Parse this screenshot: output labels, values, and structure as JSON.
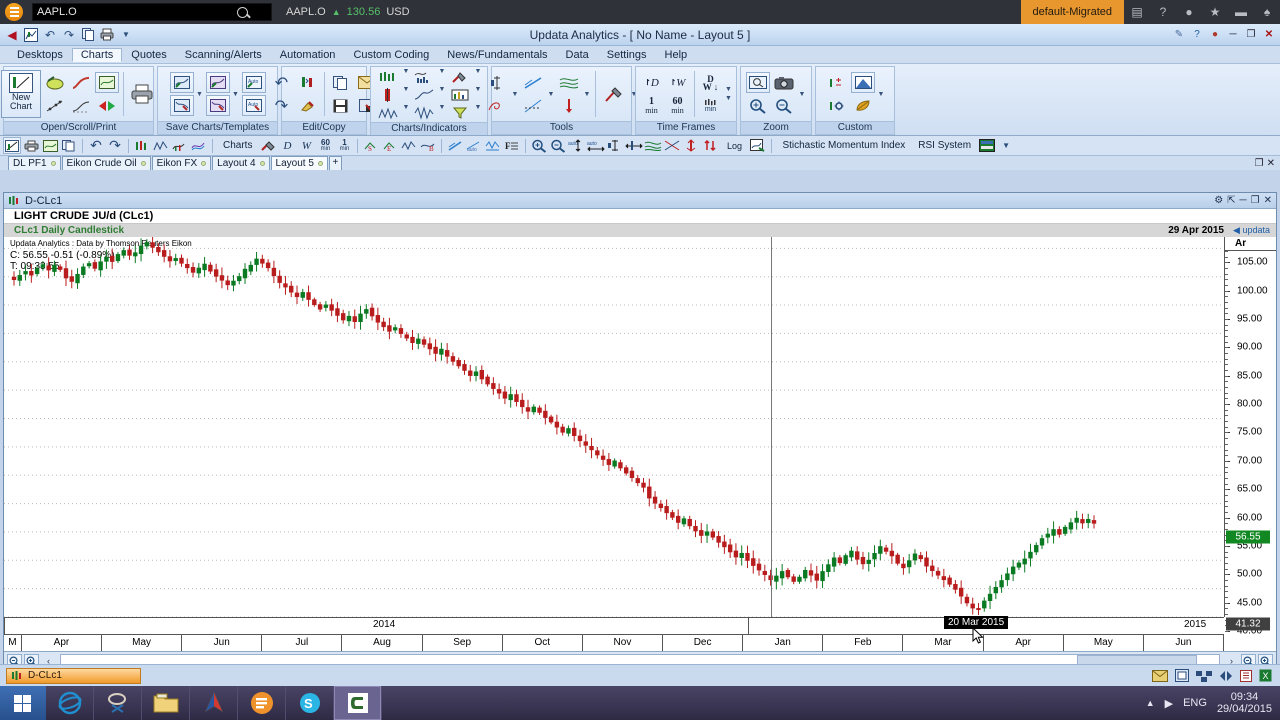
{
  "eikon": {
    "logo_icon": "eikon-logo-icon",
    "search_value": "AAPL.O",
    "search_placeholder": "Search",
    "search_icon": "search-icon",
    "quote_symbol": "AAPL.O",
    "quote_arrow": "▲",
    "quote_price": "130.56",
    "quote_currency": "USD",
    "badge": "default-Migrated",
    "icons": [
      "layout-icon",
      "help-icon",
      "chat-icon",
      "star-icon",
      "briefcase-icon",
      "bell-icon"
    ]
  },
  "window": {
    "title": "Updata Analytics - [ No Name - Layout 5 ]",
    "qat": [
      "back-arrow-icon",
      "chart-icon",
      "undo-icon",
      "redo-icon",
      "copy-icon",
      "print-icon",
      "overflow-icon"
    ],
    "controls": [
      "tools-icon",
      "help-circle-icon",
      "user-icon",
      "minimize-button",
      "restore-button",
      "close-button"
    ]
  },
  "menu": {
    "items": [
      {
        "label": "Desktops",
        "active": false
      },
      {
        "label": "Charts",
        "active": true
      },
      {
        "label": "Quotes",
        "active": false
      },
      {
        "label": "Scanning/Alerts",
        "active": false
      },
      {
        "label": "Automation",
        "active": false
      },
      {
        "label": "Custom Coding",
        "active": false
      },
      {
        "label": "News/Fundamentals",
        "active": false
      },
      {
        "label": "Data",
        "active": false
      },
      {
        "label": "Settings",
        "active": false
      },
      {
        "label": "Help",
        "active": false
      }
    ]
  },
  "ribbon": {
    "groups": [
      {
        "title": "Open/Scroll/Print",
        "big_label": "New Chart"
      },
      {
        "title": "Save Charts/Templates"
      },
      {
        "title": "Edit/Copy"
      },
      {
        "title": "Charts/Indicators"
      },
      {
        "title": "Tools"
      },
      {
        "title": "Time Frames",
        "buttons": [
          "D",
          "W",
          "D/W",
          "1 min",
          "60 min",
          "multi min"
        ]
      },
      {
        "title": "Zoom"
      },
      {
        "title": "Custom"
      }
    ]
  },
  "toolstrip": {
    "label_1": "Charts",
    "label_2": "Stichastic Momentum Index",
    "label_3": "RSI System",
    "tf_d": "D",
    "tf_w": "W",
    "tf_60": "60",
    "tf_60_sub": "min",
    "tf_1": "1",
    "tf_1_sub": "min",
    "log_label": "Log"
  },
  "tabs": {
    "items": [
      {
        "label": "DL PF1",
        "active": false
      },
      {
        "label": "Eikon Crude Oil",
        "active": false
      },
      {
        "label": "Eikon FX",
        "active": false
      },
      {
        "label": "Layout 4",
        "active": false
      },
      {
        "label": "Layout 5",
        "active": true
      }
    ],
    "add_label": "+",
    "close_icons": [
      "restore-icon",
      "close-icon"
    ]
  },
  "document": {
    "window_label": "D-CLc1",
    "window_icon": "candlestick-icon",
    "controls": [
      "gear-icon",
      "popout-icon",
      "minimize-icon",
      "restore-icon",
      "close-icon"
    ],
    "chart_title": "LIGHT CRUDE JU/d (CLc1)",
    "chart_subtitle": "CLc1 Daily Candlestick",
    "chart_date": "29 Apr 2015",
    "brand": "◀ updata",
    "source_line": "Updata Analytics : Data by Thomson Reuters Eikon",
    "quote_line": "C: 56.55   -0.51 (-0.89%)",
    "time_line": "T: 09:33:55",
    "tooltip": "20 Mar 2015"
  },
  "taskbar_app": {
    "button_label": "D-CLc1",
    "button_icon": "candlestick-icon",
    "tray_icons": [
      "mail-icon",
      "windows-icon",
      "network-icon",
      "split-icon",
      "clipboard-icon",
      "excel-icon"
    ]
  },
  "windows_taskbar": {
    "start_icon": "windows-start-icon",
    "apps": [
      "internet-explorer-icon",
      "snipping-tool-icon",
      "file-explorer-icon",
      "updata-icon",
      "eikon-icon",
      "skype-icon",
      "camtasia-icon"
    ],
    "active_app_index": 6,
    "tray_up_icon": "show-hidden-icon",
    "tray_play_icon": "media-icon",
    "language": "ENG",
    "time": "09:34",
    "date": "29/04/2015"
  },
  "chart_data": {
    "type": "line",
    "title": "LIGHT CRUDE JU/d (CLc1)",
    "subtitle": "CLc1 Daily Candlestick",
    "xlabel": "",
    "ylabel": "",
    "ylim": [
      40,
      107
    ],
    "ytick_labels": [
      "105.00",
      "100.00",
      "95.00",
      "90.00",
      "85.00",
      "80.00",
      "75.00",
      "70.00",
      "65.00",
      "60.00",
      "55.00",
      "50.00",
      "45.00",
      "40.00"
    ],
    "ytick_values": [
      105,
      100,
      95,
      90,
      85,
      80,
      75,
      70,
      65,
      60,
      55,
      50,
      45,
      40
    ],
    "y_axis_header": "Ar",
    "price_marker": "56.55",
    "low_marker": "41.32",
    "grid": true,
    "legend": "none",
    "xtick_labels": [
      "M",
      "Apr",
      "May",
      "Jun",
      "Jul",
      "Aug",
      "Sep",
      "Oct",
      "Nov",
      "Dec",
      "Jan",
      "Feb",
      "Mar",
      "Apr",
      "May",
      "Jun"
    ],
    "year_labels": [
      "2014",
      "2015"
    ],
    "close_value": 56.55,
    "change": -0.51,
    "change_pct": -0.89,
    "series": [
      {
        "name": "CLc1 Daily Close",
        "values": [
          99.5,
          100.2,
          100.9,
          100.3,
          101.4,
          102.1,
          101.2,
          102.0,
          101.3,
          99.8,
          99.2,
          100.4,
          101.7,
          102.3,
          101.5,
          102.6,
          103.4,
          102.7,
          103.9,
          104.6,
          103.8,
          104.2,
          105.4,
          106.0,
          105.2,
          104.4,
          103.6,
          102.8,
          103.2,
          102.4,
          101.6,
          100.8,
          101.5,
          102.2,
          101.0,
          100.1,
          99.4,
          98.6,
          99.2,
          100.0,
          101.3,
          102.0,
          103.1,
          102.4,
          101.6,
          100.2,
          99.0,
          98.2,
          97.3,
          96.5,
          97.2,
          96.0,
          95.1,
          94.3,
          95.0,
          94.1,
          93.2,
          92.4,
          93.0,
          92.1,
          93.4,
          94.2,
          93.1,
          92.0,
          91.2,
          90.4,
          91.0,
          90.0,
          89.2,
          88.4,
          89.0,
          88.1,
          87.3,
          86.5,
          87.2,
          86.0,
          85.1,
          84.3,
          83.5,
          82.6,
          83.2,
          82.0,
          81.1,
          80.3,
          79.5,
          78.6,
          79.2,
          78.0,
          77.1,
          76.3,
          77.0,
          76.1,
          75.2,
          74.4,
          73.5,
          72.6,
          73.2,
          72.0,
          71.1,
          70.3,
          69.5,
          68.6,
          67.8,
          66.9,
          67.5,
          66.3,
          65.4,
          64.6,
          63.7,
          62.9,
          61.0,
          60.1,
          59.3,
          58.4,
          57.6,
          56.7,
          57.3,
          56.1,
          55.2,
          54.4,
          55.0,
          54.1,
          53.2,
          52.4,
          51.5,
          50.6,
          51.2,
          50.0,
          49.1,
          48.3,
          47.5,
          46.6,
          47.2,
          48.0,
          47.1,
          46.3,
          47.0,
          48.2,
          47.4,
          46.5,
          48.0,
          49.2,
          50.4,
          49.6,
          50.8,
          51.6,
          50.2,
          49.4,
          50.0,
          51.2,
          52.4,
          51.6,
          50.8,
          49.5,
          48.7,
          49.9,
          51.1,
          50.3,
          49.0,
          48.2,
          47.4,
          46.6,
          45.8,
          44.9,
          43.7,
          42.5,
          41.6,
          41.32,
          42.8,
          44.0,
          45.2,
          46.4,
          47.6,
          48.8,
          49.5,
          50.2,
          51.4,
          52.6,
          53.8,
          54.6,
          55.4,
          54.6,
          55.8,
          56.6,
          57.4,
          56.6,
          57.2,
          56.55
        ]
      }
    ]
  }
}
